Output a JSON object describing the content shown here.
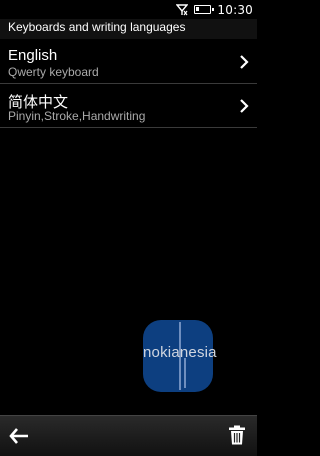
{
  "status": {
    "time": "10:30"
  },
  "header": {
    "title": "Keyboards and writing languages"
  },
  "languages": [
    {
      "title": "English",
      "subtitle": "Qwerty keyboard"
    },
    {
      "title": "简体中文",
      "subtitle": "Pinyin,Stroke,Handwriting"
    }
  ],
  "watermark": {
    "text": "nokianesia"
  },
  "colors": {
    "background": "#000000",
    "watermark": "#0d3f80",
    "subtitle": "#aaaaaa"
  },
  "icons": {
    "back": "arrow-left-icon",
    "delete": "trash-icon",
    "chevron": "chevron-right-icon"
  }
}
